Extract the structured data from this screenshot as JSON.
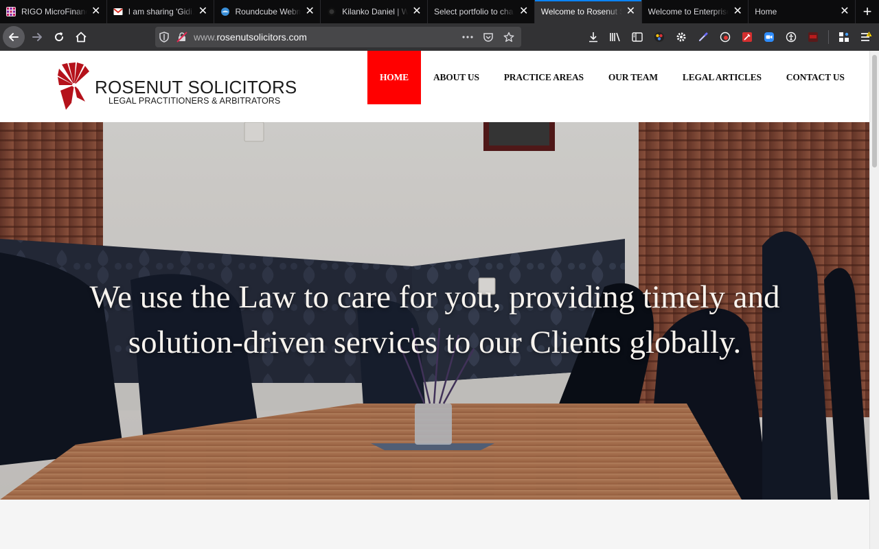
{
  "browser": {
    "tabs": [
      {
        "title": "RIGO MicroFinance",
        "favicon": "grid-favicon",
        "active": false
      },
      {
        "title": "I am sharing 'Gidi…",
        "favicon": "gmail-favicon",
        "active": false
      },
      {
        "title": "Roundcube Webmail",
        "favicon": "roundcube-favicon",
        "active": false
      },
      {
        "title": "Kilanko Daniel | Wo",
        "favicon": "github-favicon",
        "active": false
      },
      {
        "title": "Select portfolio to cha",
        "favicon": "none",
        "active": false
      },
      {
        "title": "Welcome to Rosenut S",
        "favicon": "none",
        "active": true
      },
      {
        "title": "Welcome to Enterprise",
        "favicon": "none",
        "active": false
      },
      {
        "title": "Home",
        "favicon": "none",
        "active": false
      }
    ],
    "url": {
      "prefix": "www.",
      "host": "rosenutsolicitors.com"
    },
    "accent": "#0a84ff"
  },
  "site": {
    "logo": {
      "brand": "ROSENUT SOLICITORS",
      "tagline": "LEGAL PRACTITIONERS & ARBITRATORS"
    },
    "menu": [
      {
        "label": "HOME",
        "active": true
      },
      {
        "label": "ABOUT US",
        "active": false
      },
      {
        "label": "PRACTICE AREAS",
        "active": false
      },
      {
        "label": "OUR TEAM",
        "active": false
      },
      {
        "label": "LEGAL ARTICLES",
        "active": false
      },
      {
        "label": "CONTACT US",
        "active": false
      }
    ],
    "hero": {
      "line1": "We use the Law to care for you, providing timely and",
      "line2": "solution-driven services to our Clients globally."
    },
    "colors": {
      "accent": "#ff0000",
      "brand_red": "#b5121b"
    }
  }
}
